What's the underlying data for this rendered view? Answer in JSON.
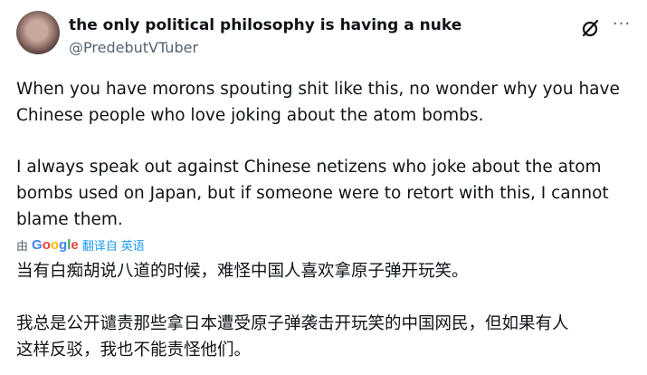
{
  "author": {
    "display_name": "the only political philosophy is having a nuke",
    "handle": "@PredebutVTuber"
  },
  "actions": {
    "grok_icon": "grok-icon",
    "more_label": "···"
  },
  "tweet": {
    "para1_line1": "When you have morons spouting shit like this, no wonder why you have",
    "para1_line2": "Chinese people who love joking about the atom bombs.",
    "para2_line1": "I always speak out against Chinese netizens who joke about the atom",
    "para2_line2": "bombs used on Japan, but if someone were to retort with this, I cannot",
    "para2_line3": "blame them."
  },
  "translation": {
    "by_label": "由",
    "google_g": "G",
    "google_o1": "o",
    "google_o2": "o",
    "google_g2": "g",
    "google_l": "l",
    "google_e": "e",
    "translated_from_label": "翻译自",
    "source_language": "英语",
    "zh_para1": "当有白痴胡说八道的时候，难怪中国人喜欢拿原子弹开玩笑。",
    "zh_para2_line1": "我总是公开谴责那些拿日本遭受原子弹袭击开玩笑的中国网民，但如果有人",
    "zh_para2_line2": "这样反驳，我也不能责怪他们。"
  }
}
